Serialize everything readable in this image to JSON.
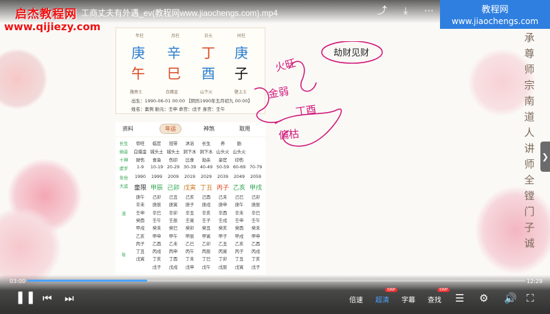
{
  "video": {
    "filename": "工商丈夫有外遇_ev(教程网www.jiaochengs.com).mp4",
    "time_current": "03:00",
    "time_total": "12:29",
    "progress": 0.24
  },
  "watermark_left": {
    "title": "启杰教程网",
    "url": "www.qijiezy.com"
  },
  "watermark_right": {
    "title": "教程网",
    "url": "www.jiaochengs.com"
  },
  "side_text": [
    "承",
    "尊",
    "师",
    "宗",
    "南",
    "道",
    "人",
    "讲",
    "师",
    "全",
    "镗",
    "门",
    "子",
    "诚"
  ],
  "chart": {
    "pillar_labels": [
      "年柱",
      "月柱",
      "日元",
      "时柱"
    ],
    "stems": [
      "庚",
      "辛",
      "丁",
      "庚"
    ],
    "branches": [
      "午",
      "巳",
      "酉",
      "子"
    ],
    "nayin": [
      "路旁土",
      "白蜡金",
      "山下火",
      "壁上土"
    ],
    "birth_line": "出生：1990-06-01 00:00 【阴历1990年五月初九 00:00】",
    "info_line": "姓名：案例   胎元：壬申  命宫：戊子  身宫：壬午"
  },
  "tabs": [
    "资料",
    "年运",
    "神煞",
    "取用"
  ],
  "grid": {
    "row_labels": [
      "长生",
      "纳音",
      "十神",
      "虚岁"
    ],
    "header_rows": [
      [
        "帝旺",
        "临官",
        "冠带",
        "沐浴",
        "长生",
        "养",
        "胎"
      ],
      [
        "白蜡金",
        "城头土",
        "城头土",
        "洞下水",
        "洞下水",
        "山头火",
        "山头火"
      ],
      [
        "财伤",
        "食枭",
        "伤印",
        "比食",
        "劫杀",
        "枭官",
        "印伤"
      ],
      [
        "1-9",
        "10-19",
        "20-29",
        "30-39",
        "40-49",
        "50-59",
        "60-69",
        "70-79"
      ]
    ],
    "years": [
      "1990",
      "1999",
      "2009",
      "2019",
      "2029",
      "2039",
      "2049",
      "2059"
    ],
    "dayun_label": "大运",
    "year_label": "年份",
    "dayun": [
      "童限",
      "甲辰",
      "己卯",
      "戊寅",
      "丁丑",
      "丙子",
      "乙亥",
      "甲戌"
    ],
    "liu_label": "流",
    "nian_label": "年",
    "liunian": [
      [
        "庚午",
        "己卯",
        "己丑",
        "己亥",
        "己酉",
        "己未",
        "己巳",
        "己卯"
      ],
      [
        "辛未",
        "庚辰",
        "庚寅",
        "庚子",
        "庚戌",
        "庚申",
        "庚午",
        "庚辰"
      ],
      [
        "壬申",
        "辛巳",
        "辛卯",
        "辛丑",
        "辛亥",
        "辛酉",
        "辛未",
        "辛巳"
      ],
      [
        "癸酉",
        "壬午",
        "壬辰",
        "壬寅",
        "壬子",
        "壬戌",
        "壬申",
        "壬午"
      ],
      [
        "甲戌",
        "癸未",
        "癸巳",
        "癸卯",
        "癸丑",
        "癸亥",
        "癸酉",
        "癸未"
      ],
      [
        "乙亥",
        "甲申",
        "甲午",
        "甲辰",
        "甲寅",
        "甲子",
        "甲戌",
        "甲申"
      ],
      [
        "丙子",
        "乙酉",
        "乙未",
        "乙巳",
        "乙卯",
        "乙丑",
        "乙亥",
        "乙酉"
      ],
      [
        "丁丑",
        "丙戌",
        "丙申",
        "丙午",
        "丙辰",
        "丙寅",
        "丙子",
        "丙戌"
      ],
      [
        "戊寅",
        "丁亥",
        "丁酉",
        "丁未",
        "丁巳",
        "丁卯",
        "丁丑",
        "丁亥"
      ],
      [
        "",
        "戊子",
        "戊戌",
        "戊申",
        "戊午",
        "戊辰",
        "戊寅",
        "戊子"
      ]
    ]
  },
  "annotations": {
    "label": "劫财见财",
    "note1": "火旺",
    "note2": "金弱",
    "note3": "丁酉",
    "note4": "偏枯"
  },
  "controls": {
    "speed": "倍速",
    "quality": "超清",
    "subtitle": "字幕",
    "search": "查找",
    "badge": "SWP"
  },
  "colors": {
    "accent": "#4da3ff",
    "annotation": "#d11b7b",
    "stem": "#2b7fcf"
  }
}
